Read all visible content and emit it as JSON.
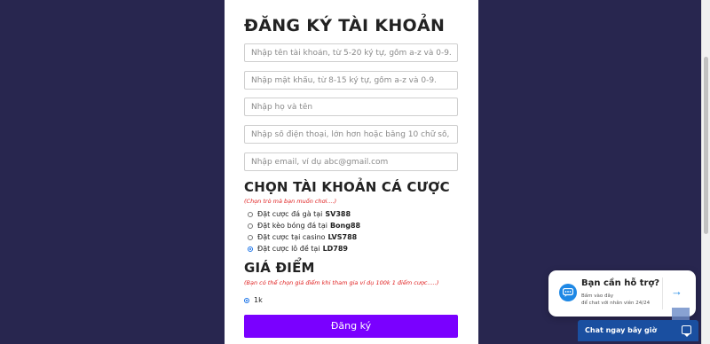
{
  "form": {
    "title": "ĐĂNG KÝ TÀI KHOẢN",
    "fields": {
      "username_placeholder": "Nhập tên tài khoản, từ 5-20 ký tự, gồm a-z và 0-9.",
      "password_placeholder": "Nhập mật khẩu, từ 8-15 ký tự, gồm a-z và 0-9.",
      "fullname_placeholder": "Nhập họ và tên",
      "phone_placeholder": "Nhập số điện thoại, lớn hơn hoặc bằng 10 chữ số, gồm 0-9.",
      "email_placeholder": "Nhập email, ví dụ abc@gmail.com"
    },
    "account_section": {
      "heading": "CHỌN TÀI KHOẢN CÁ CƯỢC",
      "note": "(Chọn trò mà bạn muốn chơi....)",
      "options": [
        {
          "text": "Đặt cược đá gà tại ",
          "brand": "SV388",
          "checked": false
        },
        {
          "text": "Đặt kèo bóng đá tại ",
          "brand": "Bong88",
          "checked": false
        },
        {
          "text": "Đặt cược tại casino ",
          "brand": "LVS788",
          "checked": false
        },
        {
          "text": "Đặt cược lô đề tại ",
          "brand": "LD789",
          "checked": true
        }
      ]
    },
    "price_section": {
      "heading": "GIÁ ĐIỂM",
      "note": "(Bạn có thể chọn giá điểm khi tham gia ví dụ 100k 1 điểm cược.....)",
      "option": {
        "label": "1k",
        "checked": true
      }
    },
    "submit_label": "Đăng ký"
  },
  "help_widget": {
    "title": "Bạn cần hỗ trợ?",
    "line1": "Bấm vào đây",
    "line2": "để chat với nhân viên 24/24",
    "arrow_icon": "arrow-right-icon"
  },
  "chat_bar": {
    "label": "Chat ngay bây giờ",
    "icon": "chat-icon"
  },
  "colors": {
    "background": "#28264f",
    "submit": "#7a00ff",
    "note_red": "#e02020",
    "chat_blue": "#1a4fa0",
    "accent_blue": "#1e88e5"
  }
}
